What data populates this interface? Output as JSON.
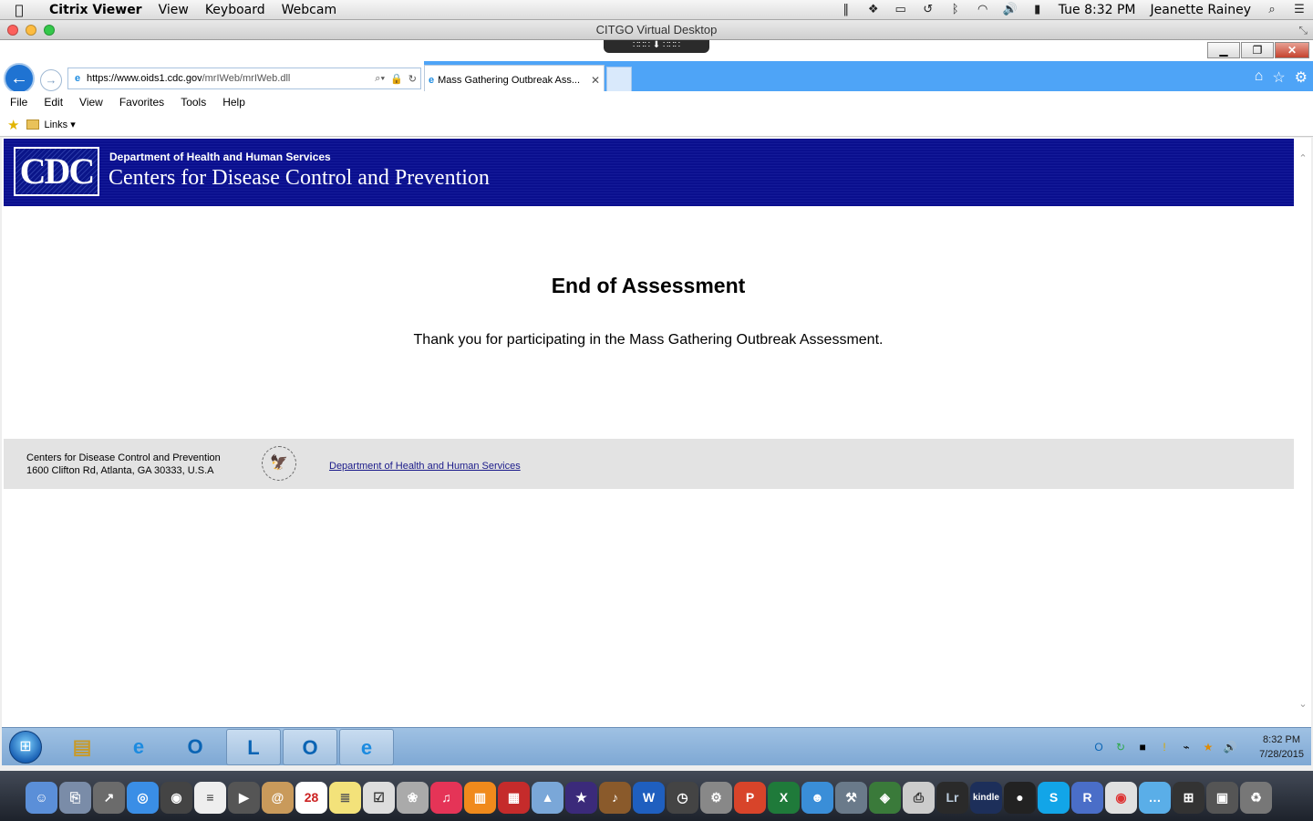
{
  "menubar": {
    "app_name": "Citrix Viewer",
    "items": [
      "View",
      "Keyboard",
      "Webcam"
    ],
    "clock": "Tue 8:32 PM",
    "user": "Jeanette Rainey"
  },
  "citrix": {
    "title": "CITGO Virtual Desktop"
  },
  "ie": {
    "url_prefix": "https://",
    "url_host": "www.oids1.cdc.gov",
    "url_path": "/mrIWeb/mrIWeb.dll",
    "tab_title": "Mass Gathering Outbreak Ass...",
    "menu": [
      "File",
      "Edit",
      "View",
      "Favorites",
      "Tools",
      "Help"
    ],
    "links_label": "Links"
  },
  "page": {
    "dept": "Department of Health and Human Services",
    "centers": "Centers for Disease Control and Prevention",
    "logo_text": "CDC",
    "heading": "End of Assessment",
    "thanks": "Thank you for participating in the Mass Gathering Outbreak Assessment.",
    "footer": {
      "org": "Centers for Disease Control and Prevention",
      "address": "1600 Clifton Rd, Atlanta, GA 30333, U.S.A",
      "link": "Department of Health and Human Services"
    }
  },
  "taskbar": {
    "time": "8:32 PM",
    "date": "7/28/2015"
  },
  "colors": {
    "cdc_navy": "#0a0f8e",
    "ie_blue": "#4ea4f7",
    "footer_gray": "#e3e3e3"
  }
}
